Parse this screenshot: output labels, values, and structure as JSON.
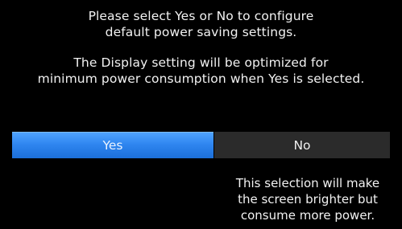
{
  "dialog": {
    "message_line_1": "Please select Yes or No to configure",
    "message_line_2": "default power saving settings.",
    "message_line_3": "The Display setting will be optimized for",
    "message_line_4": "minimum power consumption when Yes is selected."
  },
  "buttons": {
    "yes_label": "Yes",
    "no_label": "No"
  },
  "info": {
    "line_1": "This selection will make",
    "line_2": "the screen brighter but",
    "line_3": "consume more power."
  },
  "colors": {
    "background": "#000000",
    "selected_button": "#2f86f0",
    "unselected_button": "#2b2b2b",
    "text": "#f2f2f2"
  }
}
